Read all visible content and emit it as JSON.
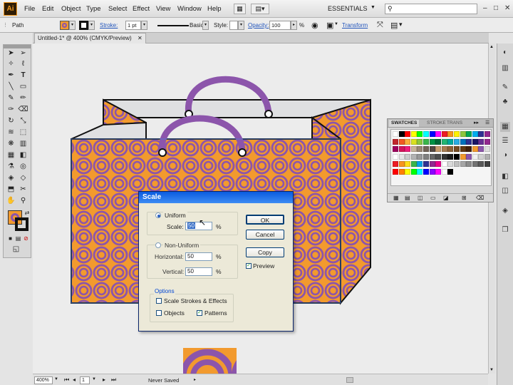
{
  "app": {
    "logo": "Ai",
    "workspace": "ESSENTIALS"
  },
  "menu": [
    "File",
    "Edit",
    "Object",
    "Type",
    "Select",
    "Effect",
    "View",
    "Window",
    "Help"
  ],
  "controlbar": {
    "selection": "Path",
    "stroke_label": "Stroke:",
    "stroke_weight": "1 pt",
    "brush": "Basic",
    "style_label": "Style:",
    "opacity_label": "Opacity:",
    "opacity_value": "100",
    "opacity_unit": "%",
    "transform_label": "Transform"
  },
  "document": {
    "tab": "Untitled-1* @ 400% (CMYK/Preview)"
  },
  "status": {
    "zoom": "400%",
    "page": "1",
    "state": "Never Saved"
  },
  "swatches": {
    "tabs": [
      "SWATCHES",
      "STROKE",
      "TRANS"
    ]
  },
  "dialog": {
    "title": "Scale",
    "uniform": "Uniform",
    "scale_label": "Scale:",
    "scale_value": "50",
    "percent": "%",
    "non_uniform": "Non-Uniform",
    "horizontal_label": "Horizontal:",
    "horizontal_value": "50",
    "vertical_label": "Vertical:",
    "vertical_value": "50",
    "options": "Options",
    "scale_strokes": "Scale Strokes & Effects",
    "objects": "Objects",
    "patterns": "Patterns",
    "ok": "OK",
    "cancel": "Cancel",
    "copy": "Copy",
    "preview": "Preview",
    "state": {
      "uniform": true,
      "scale_strokes": false,
      "objects": false,
      "patterns": true,
      "preview": true
    }
  },
  "colors": {
    "orange": "#f29a2e",
    "purple": "#8c55ab",
    "bag_panel": "#dfe0e2"
  }
}
